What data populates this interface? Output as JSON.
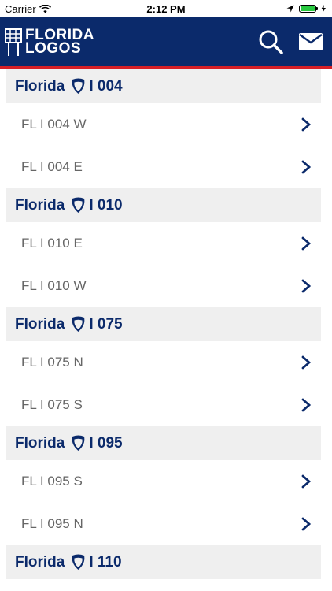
{
  "status": {
    "carrier": "Carrier",
    "time": "2:12 PM"
  },
  "header": {
    "logo_line1": "FLORIDA",
    "logo_line2": "LOGOS"
  },
  "colors": {
    "navy": "#0b2a6b",
    "red": "#d71f26",
    "section_bg": "#efefef"
  },
  "sections": [
    {
      "title": "Florida",
      "highway": "I 004",
      "rows": [
        "FL I 004 W",
        "FL I 004 E"
      ]
    },
    {
      "title": "Florida",
      "highway": "I 010",
      "rows": [
        "FL I 010 E",
        "FL I 010 W"
      ]
    },
    {
      "title": "Florida",
      "highway": "I 075",
      "rows": [
        "FL I 075 N",
        "FL I 075 S"
      ]
    },
    {
      "title": "Florida",
      "highway": "I 095",
      "rows": [
        "FL I 095 S",
        "FL I 095 N"
      ]
    },
    {
      "title": "Florida",
      "highway": "I 110",
      "rows": []
    }
  ]
}
